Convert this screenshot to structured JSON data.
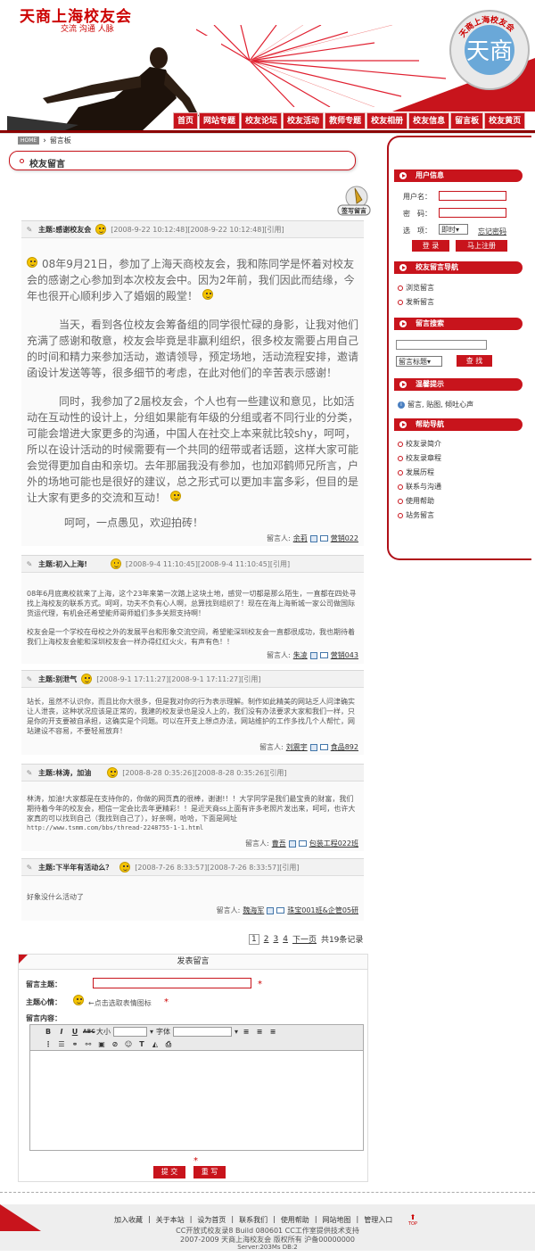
{
  "header": {
    "brand": "天商上海校友会",
    "slogan": "交流 沟通 人脉",
    "logo_text": "天商上海校友会",
    "nav": [
      "首页",
      "网站专题",
      "校友论坛",
      "校友活动",
      "教师专题",
      "校友相册",
      "校友信息",
      "留言板",
      "校友黄页"
    ]
  },
  "breadcrumb": {
    "home": "HOME",
    "current": "留言板"
  },
  "section_title": "校友留言",
  "sign_label": "签写留言",
  "posts": [
    {
      "subject": "主题:感谢校友会",
      "meta": "[2008-9-22 10:12:48][2008-9-22 10:12:48][引用]",
      "paragraphs": [
        "08年9月21日，参加了上海天商校友会，我和陈同学是怀着对校友会的感谢之心参加到本次校友会中。因为2年前，我们因此而结缘，今年也很开心顺利步入了婚姻的殿堂！",
        "当天，看到各位校友会筹备组的同学很忙碌的身影，让我对他们充满了感谢和敬意，校友会毕竟是非赢利组织，很多校友需要占用自己的时间和精力来参加活动，邀请领导，预定场地，活动流程安排，邀请函设计发送等等，很多细节的考虑，在此对他们的辛苦表示感谢！",
        "同时，我参加了2届校友会，个人也有一些建议和意见，比如活动在互动性的设计上，分组如果能有年级的分组或者不同行业的分类，可能会增进大家更多的沟通，中国人在社交上本来就比较shy，呵呵，所以在设计活动的时候需要有一个共同的纽带或者话题，这样大家可能会觉得更加自由和亲切。去年那届我没有参加，也加邓鹤师兄所言，户外的场地可能也是很好的建议，总之形式可以更加丰富多彩，但目的是让大家有更多的交流和互动！",
        "呵呵，一点愚见，欢迎拍砖！"
      ],
      "author_label": "留言人:",
      "author": "余莉",
      "group": "营销022"
    },
    {
      "subject": "主题:初入上海!",
      "meta": "[2008-9-4 11:10:45][2008-9-4 11:10:45][引用]",
      "paragraphs": [
        "08年6月底离校就来了上海，这个23年来第一次踏上这块土地，感觉一切都是那么陌生，一直都在四处寻找上海校友的联系方式。呵呵，功夫不负有心人啊，总算找到组织了！现在在海上海新城一家公司做国际货运代理，有机会还希望能师哥师姐们多多关照支持啊！",
        "校友会是一个学校在母校之外的发展平台和形象交流空间，希望能深圳校友会一直都很成功，我也期待着我们上海校友会能和深圳校友会一样办得红红火火，有声有色！！"
      ],
      "author_label": "留言人:",
      "author": "朱凌",
      "group": "营销043"
    },
    {
      "subject": "主题:别泄气",
      "meta": "[2008-9-1 17:11:27][2008-9-1 17:11:27][引用]",
      "paragraphs": [
        "站长，虽然不认识你，而且比你大很多，但是我对你的行为表示理解。制作如此精美的网站乏人问津确实让人泄丧，这种状况应该是正常的，我建的校友录也是没人上的，我们没有办法要求大家和我们一样，只是你的开支要被自承担，这确实是个问题。可以在开支上想点办法，网站维护的工作多找几个人帮忙，网站建设不容易，不要轻易放弃！"
      ],
      "author_label": "留言人:",
      "author": "刘震宇",
      "group": "食品892"
    },
    {
      "subject": "主题:林涛，加油",
      "meta": "[2008-8-28 0:35:26][2008-8-28 0:35:26][引用]",
      "paragraphs": [
        "林涛，加油!大家都是在支持你的，你做的网页真的很棒，谢谢!！！大学同学是我们最宝贵的财富，我们期待着今年的校友会，相信一定会比去年更精彩！！是近天商ss上面有许多老照片发出来，呵呵，也许大家真的可以找到自己（我找到自己了），好亲啊，哈哈，下面是网址",
        "http://www.tsmm.com/bbs/thread-2248755-1-1.html"
      ],
      "author_label": "留言人:",
      "author": "曹吾",
      "group": "包装工程022班"
    },
    {
      "subject": "主题:下半年有活动么？",
      "meta": "[2008-7-26 8:33:57][2008-7-26 8:33:57][引用]",
      "paragraphs": [
        "好象没什么活动了"
      ],
      "author_label": "留言人:",
      "author": "魏海军",
      "group": "珠宝001班&企管05研"
    }
  ],
  "pager": {
    "pages": [
      "1",
      "2",
      "3",
      "4"
    ],
    "next": "下一页",
    "total": "共19条记录"
  },
  "form": {
    "heading": "发表留言",
    "subject_label": "留言主题：",
    "mood_label": "主题心情：",
    "mood_hint": "←点击选取表情图标",
    "content_label": "留言内容：",
    "size_label": "大小",
    "font_label": "字体",
    "submit": "提 交",
    "reset": "重 写",
    "required": "*"
  },
  "sidebar": {
    "user_info": {
      "title": "用户信息",
      "username_label": "用户名：",
      "password_label": "密　码：",
      "option_label": "选　项：",
      "option_value": "即时",
      "forgot": "忘记密码",
      "login": "登 录",
      "register": "马上注册"
    },
    "nav": {
      "title": "校友留言导航",
      "items": [
        "浏览留言",
        "发新留言"
      ]
    },
    "search": {
      "title": "留言搜索",
      "select_value": "留言标题",
      "button": "查 找"
    },
    "tip": {
      "title": "温馨提示",
      "text": "留言, 贴图, 倾吐心声"
    },
    "help": {
      "title": "帮助导航",
      "items": [
        "校友录简介",
        "校友录章程",
        "发展历程",
        "联系与沟通",
        "使用帮助",
        "站务留言"
      ]
    }
  },
  "footer": {
    "links": [
      "加入收藏",
      "关于本站",
      "设为首页",
      "联系我们",
      "使用帮助",
      "网站地图",
      "管理入口"
    ],
    "top": "TOP",
    "line1": "CC开放式校友录8 Build 080601 CC工作室提供技术支持",
    "line2": "2007-2009 天商上海校友会 版权所有 沪备00000000",
    "line3": "Server:203Ms  DB:2"
  },
  "colors": {
    "accent": "#c8141c",
    "dark_red": "#8b0000"
  }
}
